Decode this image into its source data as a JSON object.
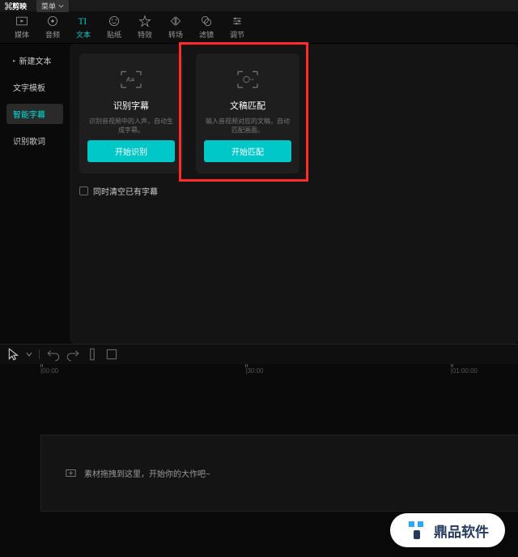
{
  "header": {
    "app_name": "剪映",
    "menu_label": "菜单"
  },
  "toolbar": [
    {
      "id": "media",
      "label": "媒体"
    },
    {
      "id": "audio",
      "label": "音频"
    },
    {
      "id": "text",
      "label": "文本",
      "active": true
    },
    {
      "id": "sticker",
      "label": "贴纸"
    },
    {
      "id": "fx",
      "label": "特效"
    },
    {
      "id": "transition",
      "label": "转场"
    },
    {
      "id": "filter",
      "label": "滤镜"
    },
    {
      "id": "adjust",
      "label": "调节"
    }
  ],
  "sidebar": [
    {
      "id": "new-text",
      "label": "新建文本",
      "expand": true
    },
    {
      "id": "template",
      "label": "文字模板"
    },
    {
      "id": "smart-sub",
      "label": "智能字幕",
      "active": true
    },
    {
      "id": "lyrics",
      "label": "识别歌词"
    }
  ],
  "cards": [
    {
      "id": "recognize",
      "title": "识别字幕",
      "desc": "识别音视频中的人声，自动生成字幕。",
      "button": "开始识别"
    },
    {
      "id": "match",
      "title": "文稿匹配",
      "desc": "输入音视频对应的文稿，自动匹配画面。",
      "button": "开始匹配",
      "highlighted": true
    }
  ],
  "clear_checkbox": "同时清空已有字幕",
  "ruler": [
    "00:00",
    "30:00",
    "01:00:00"
  ],
  "timeline_placeholder": "素材拖拽到这里，开始你的大作吧~",
  "watermark": "鼎品软件"
}
